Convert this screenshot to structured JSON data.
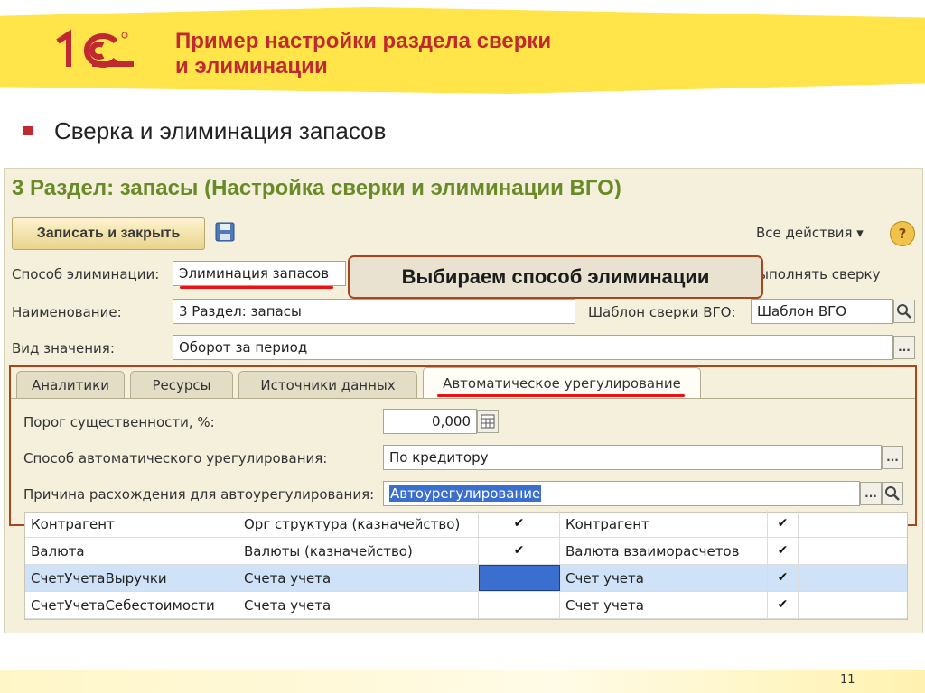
{
  "slide": {
    "title_line1": "Пример настройки раздела сверки",
    "title_line2": "и элиминации",
    "subtitle": "Сверка и элиминация запасов",
    "page_number": "11",
    "accent_color": "#c0292f"
  },
  "form": {
    "title": "3 Раздел: запасы (Настройка сверки и элиминации ВГО)",
    "save_close_label": "Записать и закрыть",
    "all_actions_label": "Все действия ▾",
    "help_label": "?",
    "elim_method_label": "Способ элиминации:",
    "elim_method_value": "Элиминация запасов",
    "callout_text": "Выбираем способ элиминации",
    "skip_recon_label": "Не выполнять сверку",
    "name_label": "Наименование:",
    "name_value": "3 Раздел: запасы",
    "template_label": "Шаблон сверки ВГО:",
    "template_value": "Шаблон ВГО",
    "value_type_label": "Вид значения:",
    "value_type_value": "Оборот за период",
    "ellipsis": "..."
  },
  "tabs": [
    {
      "label": "Аналитики"
    },
    {
      "label": "Ресурсы"
    },
    {
      "label": "Источники данных"
    },
    {
      "label": "Автоматическое урегулирование"
    }
  ],
  "auto": {
    "threshold_label": "Порог существенности, %:",
    "threshold_value": "0,000",
    "method_label": "Способ автоматического урегулирования:",
    "method_value": "По кредитору",
    "reason_label": "Причина расхождения для автоурегулирования:",
    "reason_value": "Автоурегулирование"
  },
  "grid": {
    "rows": [
      {
        "c1": "Контрагент",
        "c2": "Орг структура (казначейство)",
        "c3": "✔",
        "c4": "Контрагент",
        "c5": "✔"
      },
      {
        "c1": "Валюта",
        "c2": "Валюты (казначейство)",
        "c3": "✔",
        "c4": "Валюта взаиморасчетов",
        "c5": "✔"
      },
      {
        "c1": "СчетУчетаВыручки",
        "c2": "Счета учета",
        "c3": "",
        "c4": "Счет учета",
        "c5": "✔"
      },
      {
        "c1": "СчетУчетаСебестоимости",
        "c2": "Счета учета",
        "c3": "",
        "c4": "Счет учета",
        "c5": "✔"
      }
    ]
  }
}
